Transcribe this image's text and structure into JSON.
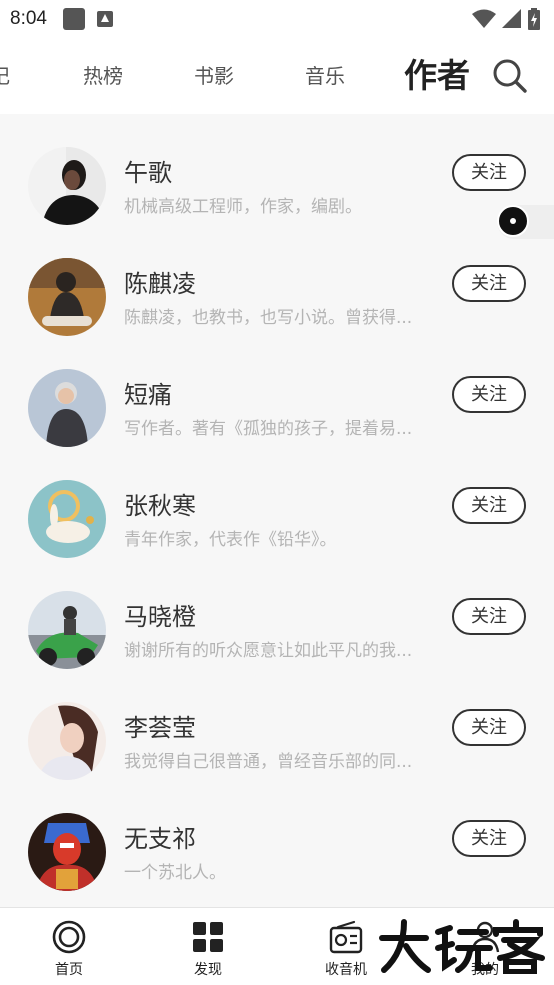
{
  "status_bar": {
    "time": "8:04"
  },
  "top_tabs": [
    {
      "label": "记",
      "active": false
    },
    {
      "label": "热榜",
      "active": false
    },
    {
      "label": "书影",
      "active": false
    },
    {
      "label": "音乐",
      "active": false
    },
    {
      "label": "作者",
      "active": true
    }
  ],
  "follow_label": "关注",
  "authors": [
    {
      "name": "午歌",
      "desc": "机械高级工程师，作家，编剧。"
    },
    {
      "name": "陈麒凌",
      "desc": "陈麒凌，也教书，也写小说。曾获得..."
    },
    {
      "name": "短痛",
      "desc": "写作者。著有《孤独的孩子，提着易..."
    },
    {
      "name": "张秋寒",
      "desc": "青年作家，代表作《铅华》。"
    },
    {
      "name": "马晓橙",
      "desc": "谢谢所有的听众愿意让如此平凡的我..."
    },
    {
      "name": "李荟莹",
      "desc": "我觉得自己很普通，曾经音乐部的同..."
    },
    {
      "name": "无支祁",
      "desc": "一个苏北人。"
    }
  ],
  "bottom_nav": [
    {
      "label": "首页",
      "icon": "home-ring-icon"
    },
    {
      "label": "发现",
      "icon": "grid-icon"
    },
    {
      "label": "收音机",
      "icon": "radio-icon"
    },
    {
      "label": "我的",
      "icon": "person-icon"
    }
  ],
  "watermark": {
    "text": "大玩客"
  },
  "colors": {
    "accent": "#222222",
    "subtext": "#b4b4b4",
    "list_bg": "#f7f7f7"
  }
}
